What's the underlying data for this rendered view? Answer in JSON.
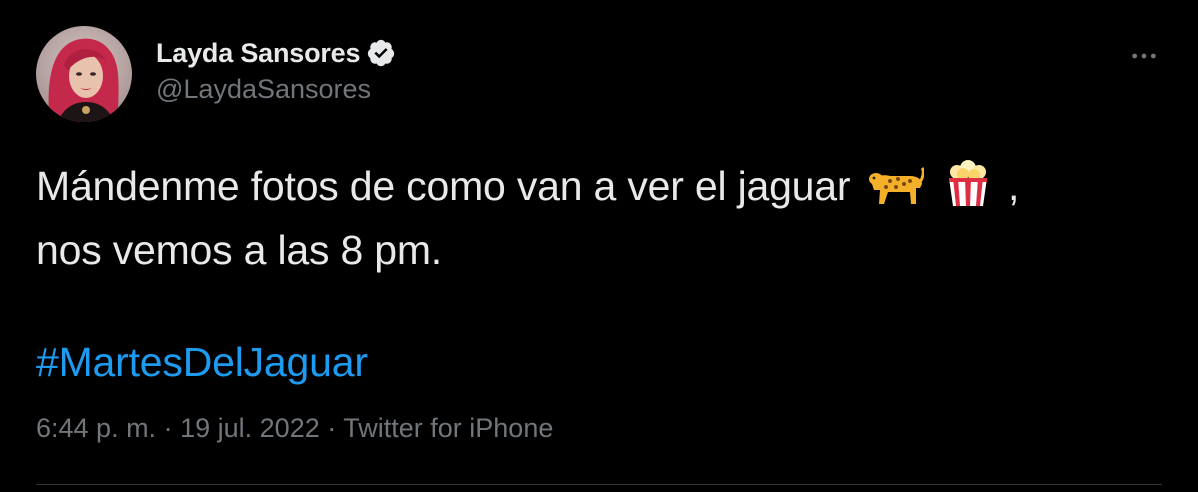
{
  "author": {
    "display_name": "Layda Sansores",
    "handle": "@LaydaSansores",
    "verified": true,
    "avatar_icon": "profile-photo"
  },
  "tweet": {
    "text_part1": "Mándenme fotos de como van a ver el jaguar",
    "emoji1": "leopard-emoji",
    "emoji2": "popcorn-emoji",
    "text_part2": ",",
    "text_line2": "nos vemos a las 8 pm.",
    "hashtag": "#MartesDelJaguar"
  },
  "meta": {
    "time": "6:44 p. m.",
    "separator1": "·",
    "date": "19 jul. 2022",
    "separator2": "·",
    "source": "Twitter for iPhone"
  },
  "colors": {
    "background": "#000000",
    "text": "#e7e9ea",
    "secondary": "#71767b",
    "link": "#1d9bf0"
  }
}
